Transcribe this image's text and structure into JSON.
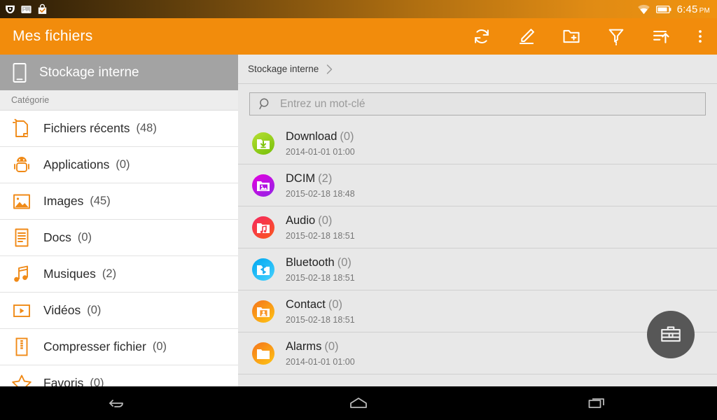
{
  "statusbar": {
    "icons": [
      "shield-notification-icon",
      "photo-notification-icon",
      "play-store-update-icon"
    ],
    "wifi_icon": "wifi-icon",
    "battery_icon": "battery-icon",
    "time": "6:45",
    "meridiem": "PM"
  },
  "actionbar": {
    "title": "Mes fichiers",
    "actions": [
      {
        "name": "refresh-button",
        "icon": "refresh-icon"
      },
      {
        "name": "edit-button",
        "icon": "pencil-icon"
      },
      {
        "name": "new-folder-button",
        "icon": "folder-plus-icon"
      },
      {
        "name": "filter-button",
        "icon": "funnel-icon"
      },
      {
        "name": "sort-button",
        "icon": "sort-ascending-icon"
      },
      {
        "name": "overflow-menu-button",
        "icon": "more-vertical-icon"
      }
    ]
  },
  "sidebar": {
    "storage": {
      "label": "Stockage interne",
      "icon": "tablet-icon"
    },
    "category_header": "Catégorie",
    "items": [
      {
        "label": "Fichiers récents",
        "count": "(48)",
        "icon": "recent-file-icon"
      },
      {
        "label": "Applications",
        "count": "(0)",
        "icon": "android-icon"
      },
      {
        "label": "Images",
        "count": "(45)",
        "icon": "image-icon"
      },
      {
        "label": "Docs",
        "count": "(0)",
        "icon": "document-icon"
      },
      {
        "label": "Musiques",
        "count": "(2)",
        "icon": "music-note-icon"
      },
      {
        "label": "Vidéos",
        "count": "(0)",
        "icon": "video-play-icon"
      },
      {
        "label": "Compresser fichier",
        "count": "(0)",
        "icon": "zip-icon"
      },
      {
        "label": "Favoris",
        "count": "(0)",
        "icon": "star-icon"
      }
    ]
  },
  "content": {
    "breadcrumb": {
      "root": "Stockage interne",
      "separator_icon": "chevron-right-icon"
    },
    "search": {
      "placeholder": "Entrez un mot-clé",
      "icon": "search-icon",
      "value": ""
    },
    "files": [
      {
        "name": "Download",
        "count": "(0)",
        "date": "2014-01-01 01:00",
        "icon": "folder-download-icon",
        "color_from": "#8CC717",
        "color_to": "#B6DF33"
      },
      {
        "name": "DCIM",
        "count": "(2)",
        "date": "2015-02-18 18:48",
        "icon": "folder-image-icon",
        "color_from": "#D800D8",
        "color_to": "#A617E0"
      },
      {
        "name": "Audio",
        "count": "(0)",
        "date": "2015-02-18 18:51",
        "icon": "folder-music-icon",
        "color_from": "#F5275F",
        "color_to": "#FA4A2B"
      },
      {
        "name": "Bluetooth",
        "count": "(0)",
        "date": "2015-02-18 18:51",
        "icon": "folder-bluetooth-icon",
        "color_from": "#00A7F0",
        "color_to": "#2FC3FA"
      },
      {
        "name": "Contact",
        "count": "(0)",
        "date": "2015-02-18 18:51",
        "icon": "folder-contact-icon",
        "color_from": "#F57C1B",
        "color_to": "#FCB516"
      },
      {
        "name": "Alarms",
        "count": "(0)",
        "date": "2014-01-01 01:00",
        "icon": "folder-plain-icon",
        "color_from": "#F57C1B",
        "color_to": "#FCB516"
      }
    ]
  },
  "fab": {
    "icon": "toolbox-icon"
  },
  "navbar": {
    "buttons": [
      {
        "name": "nav-back-button",
        "icon": "back-arrow-icon"
      },
      {
        "name": "nav-home-button",
        "icon": "home-icon"
      },
      {
        "name": "nav-recents-button",
        "icon": "recents-icon"
      }
    ]
  },
  "colors": {
    "accent": "#F28C0C",
    "content_bg": "#E8E8E8",
    "sidebar_header": "#A3A3A3",
    "divider": "#CFCFCF"
  }
}
